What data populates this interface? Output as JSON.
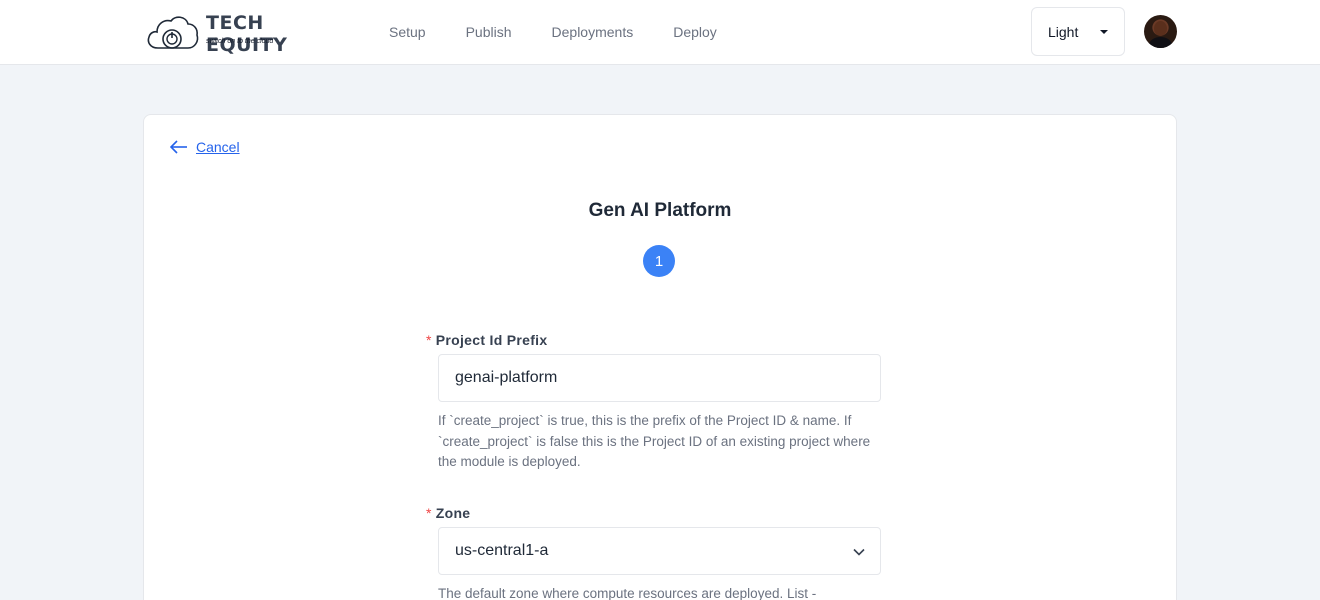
{
  "brand": {
    "name": "TECH EQUITY",
    "tagline": "switch on to the cloud"
  },
  "nav": {
    "items": [
      {
        "label": "Setup"
      },
      {
        "label": "Publish"
      },
      {
        "label": "Deployments"
      },
      {
        "label": "Deploy"
      }
    ]
  },
  "theme": {
    "selected": "Light"
  },
  "page": {
    "cancel_label": "Cancel",
    "title": "Gen AI Platform",
    "step_number": "1"
  },
  "form": {
    "project_id_prefix": {
      "label": "Project Id Prefix",
      "required_mark": "*",
      "value": "genai-platform",
      "help": "If `create_project` is true, this is the prefix of the Project ID & name. If `create_project` is false this is the Project ID of an existing project where the module is deployed."
    },
    "zone": {
      "label": "Zone",
      "required_mark": "*",
      "value": "us-central1-a",
      "help": "The default zone where compute resources are deployed. List -"
    }
  },
  "colors": {
    "accent": "#3b82f6",
    "link": "#2563eb",
    "required": "#ef4444",
    "background": "#f1f4f8"
  }
}
